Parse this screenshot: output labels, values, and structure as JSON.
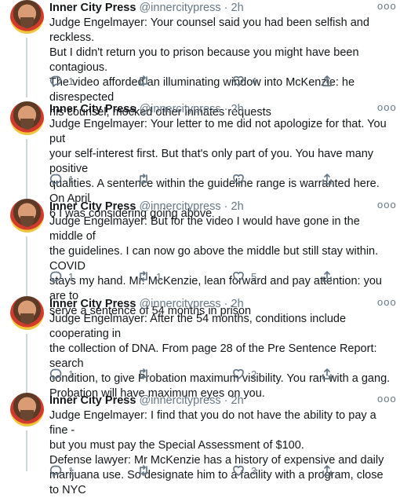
{
  "tweets": [
    {
      "name": "Inner City Press",
      "handle": "@innercitypress",
      "sep": "·",
      "time": "2h",
      "lines": [
        "Judge Engelmayer: Your counsel said you had been selfish and reckless.",
        "But I didn't return you to prison because you might have been contagious.",
        "The video afforded an illuminating window into McKenzie: he disrespected",
        "his counsel, mocked other inmates requests"
      ],
      "replies": "1",
      "retweets": "",
      "likes": "4"
    },
    {
      "name": "Inner City Press",
      "handle": "@innercitypress",
      "sep": "·",
      "time": "2h",
      "lines": [
        "Judge Engelmayer: Your letter to me did not apologize for that. You put",
        "your self-interest first. But that's only part of you. You have many positive",
        "qualities. A sentence within the guideline range is warranted here. On April",
        "6 I was considering going above"
      ],
      "replies": "1",
      "retweets": "",
      "likes": ""
    },
    {
      "name": "Inner City Press",
      "handle": "@innercitypress",
      "sep": "·",
      "time": "2h",
      "lines": [
        "Judge Engelmayer: But for the video I would have gone in the middle of",
        "the guidelines. I can now go above the middle but still stay within. COVID",
        "stays my hand. Mr. McKenzie, lean forward and pay attention: you are to",
        "serve a sentence of 54 months in prison"
      ],
      "replies": "1",
      "retweets": "1",
      "likes": "5"
    },
    {
      "name": "Inner City Press",
      "handle": "@innercitypress",
      "sep": "·",
      "time": "2h",
      "lines": [
        "Judge Engelmayer: After the 54 months, conditions include cooperating in",
        "the collection of DNA. From page 28 of the Pre Sentence Report: search",
        "condition, to give Probation maximum visibility. You ran with a gang.",
        "Probation will have maximum eyes on you."
      ],
      "replies": "1",
      "retweets": "",
      "likes": "2"
    },
    {
      "name": "Inner City Press",
      "handle": "@innercitypress",
      "sep": "·",
      "time": "2h",
      "lines": [
        "Judge Engelmayer: I find that you do not have the ability to pay a fine -",
        "but you must pay the Special Assessment of $100.",
        "Defense lawyer: Mr McKenzie has a history of expensive and daily",
        "marijuana use. So designate him to a facility with a program, close to NYC"
      ],
      "replies": "1",
      "retweets": "",
      "likes": "3"
    }
  ],
  "more_glyph": "ooo",
  "icons": {
    "reply": "reply-icon",
    "retweet": "retweet-icon",
    "like": "heart-icon",
    "share": "share-icon",
    "more": "more-options-icon"
  }
}
